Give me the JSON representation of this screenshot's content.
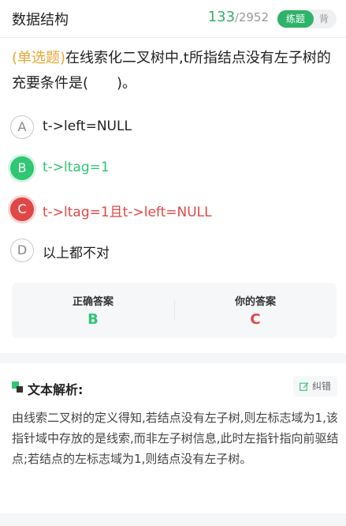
{
  "header": {
    "title": "数据结构",
    "progress_current": "133",
    "progress_sep": "/",
    "progress_total": "2952",
    "mode_active": "练题",
    "mode_inactive": "背"
  },
  "question": {
    "type": "(单选题)",
    "text": "在线索化二叉树中,t所指结点没有左子树的充要条件是(　　)。"
  },
  "options": [
    {
      "letter": "A",
      "text": "t->left=NULL",
      "state": "normal"
    },
    {
      "letter": "B",
      "text": "t->ltag=1",
      "state": "correct"
    },
    {
      "letter": "C",
      "text": "t->ltag=1且t->left=NULL",
      "state": "wrong"
    },
    {
      "letter": "D",
      "text": "以上都不对",
      "state": "normal"
    }
  ],
  "answers": {
    "correct_label": "正确答案",
    "correct_value": "B",
    "yours_label": "你的答案",
    "yours_value": "C"
  },
  "analysis": {
    "title": "文本解析:",
    "fix_label": "纠错",
    "text": "由线索二叉树的定义得知,若结点没有左子树,则左标志域为1,该指针域中存放的是线索,而非左子树信息,此时左指针指向前驱结点;若结点的左标志域为1,则结点没有左子树。"
  },
  "colors": {
    "accent_green": "#2fc674",
    "error_red": "#e04747",
    "type_orange": "#e7a731"
  }
}
